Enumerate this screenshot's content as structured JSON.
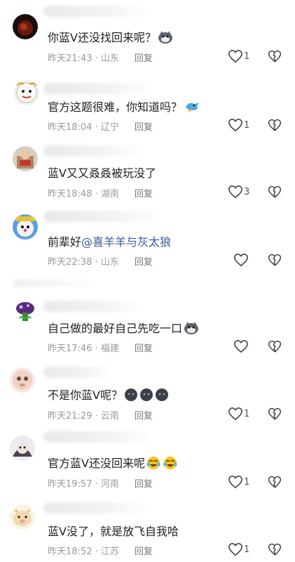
{
  "comments": [
    {
      "text": "你蓝V还没找回来呢？",
      "time": "昨天21:43",
      "location": "山东",
      "reply": "回复",
      "likes": "1"
    },
    {
      "text": "官方这题很难，你知道吗？",
      "time": "昨天18:04",
      "location": "辽宁",
      "reply": "回复",
      "likes": "1"
    },
    {
      "text": "蓝V又又叒叒被玩没了",
      "time": "昨天18:48",
      "location": "湖南",
      "reply": "回复",
      "likes": "3"
    },
    {
      "text": "前辈好",
      "mention": "@喜羊羊与灰太狼",
      "time": "昨天22:38",
      "location": "山东",
      "reply": "回复",
      "likes": ""
    },
    {
      "text": "自己做的最好自己先吃一口",
      "time": "昨天17:46",
      "location": "福建",
      "reply": "回复",
      "likes": ""
    },
    {
      "text": "不是你蓝V呢？",
      "time": "昨天21:29",
      "location": "云南",
      "reply": "回复",
      "likes": "1"
    },
    {
      "text": "官方蓝V还没回来呢",
      "time": "昨天19:57",
      "location": "河南",
      "reply": "回复",
      "likes": "1"
    },
    {
      "text": "蓝V没了，就是放飞自我哈",
      "time": "昨天18:52",
      "location": "江苏",
      "reply": "回复",
      "likes": "1"
    }
  ],
  "separator": " · ",
  "colors": {
    "text": "#222222",
    "meta": "#9a9a9a",
    "mention": "#3c5a99",
    "icon": "#444444"
  }
}
